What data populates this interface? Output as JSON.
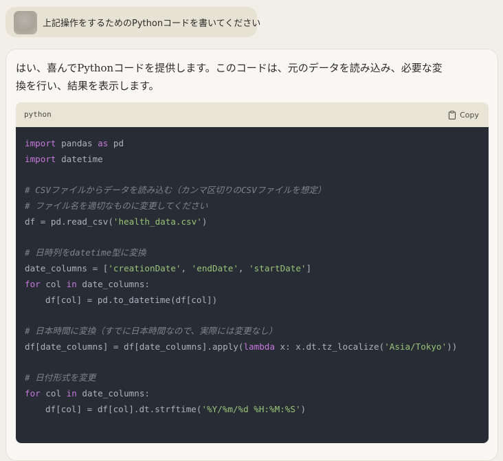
{
  "user_message": {
    "text": "上記操作をするためのPythonコードを書いてください"
  },
  "assistant": {
    "intro_line1": "はい、喜んでPythonコードを提供します。このコードは、元のデータを読み込み、必要な変",
    "intro_line2": "換を行い、結果を表示します。"
  },
  "code_block": {
    "language": "python",
    "copy_label": "Copy",
    "copy_icon": "clipboard-icon",
    "colors": {
      "background": "#282c34",
      "keyword": "#c678dd",
      "string": "#98c379",
      "comment": "#7f848e",
      "text": "#abb2bf"
    },
    "lines": {
      "l1_kw1": "import",
      "l1_t1": " pandas ",
      "l1_kw2": "as",
      "l1_t2": " pd",
      "l2_kw": "import",
      "l2_t": " datetime",
      "l4_cm": "# CSVファイルからデータを読み込む（カンマ区切りのCSVファイルを想定）",
      "l5_cm": "# ファイル名を適切なものに変更してください",
      "l6_t1": "df = pd.read_csv(",
      "l6_str": "'health_data.csv'",
      "l6_t2": ")",
      "l8_cm": "# 日時列をdatetime型に変換",
      "l9_t1": "date_columns = [",
      "l9_s1": "'creationDate'",
      "l9_c1": ", ",
      "l9_s2": "'endDate'",
      "l9_c2": ", ",
      "l9_s3": "'startDate'",
      "l9_t2": "]",
      "l10_kw1": "for",
      "l10_t1": " col ",
      "l10_kw2": "in",
      "l10_t2": " date_columns:",
      "l11_t": "df[col] = pd.to_datetime(df[col])",
      "l13_cm": "# 日本時間に変換（すでに日本時間なので、実際には変更なし）",
      "l14_t1": "df[date_columns] = df[date_columns].apply(",
      "l14_kw": "lambda",
      "l14_t2": " x: x.dt.tz_localize(",
      "l14_str": "'Asia/Tokyo'",
      "l14_t3": "))",
      "l16_cm": "# 日付形式を変更",
      "l17_kw1": "for",
      "l17_t1": " col ",
      "l17_kw2": "in",
      "l17_t2": " date_columns:",
      "l18_t1": "df[col] = df[col].dt.strftime(",
      "l18_str": "'%Y/%m/%d %H:%M:%S'",
      "l18_t2": ")"
    }
  }
}
